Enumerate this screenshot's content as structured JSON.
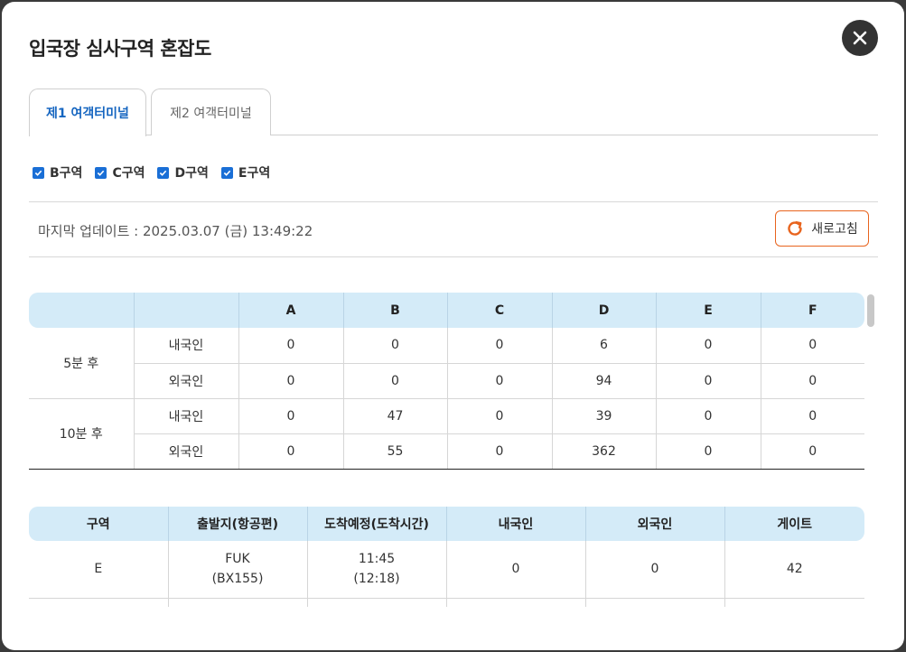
{
  "modal": {
    "title": "입국장 심사구역 혼잡도"
  },
  "tabs": [
    {
      "label": "제1 여객터미널",
      "active": true
    },
    {
      "label": "제2 여객터미널",
      "active": false
    }
  ],
  "filters": [
    {
      "label": "B구역",
      "checked": true
    },
    {
      "label": "C구역",
      "checked": true
    },
    {
      "label": "D구역",
      "checked": true
    },
    {
      "label": "E구역",
      "checked": true
    }
  ],
  "status": {
    "last_update": "마지막 업데이트 : 2025.03.07 (금) 13:49:22",
    "refresh_label": "새로고침"
  },
  "congestion_table": {
    "columns": [
      "",
      "",
      "A",
      "B",
      "C",
      "D",
      "E",
      "F"
    ],
    "groups": [
      {
        "label": "5분 후",
        "rows": [
          {
            "type": "내국인",
            "values": [
              "0",
              "0",
              "0",
              "6",
              "0",
              "0"
            ]
          },
          {
            "type": "외국인",
            "values": [
              "0",
              "0",
              "0",
              "94",
              "0",
              "0"
            ]
          }
        ]
      },
      {
        "label": "10분 후",
        "rows": [
          {
            "type": "내국인",
            "values": [
              "0",
              "47",
              "0",
              "39",
              "0",
              "0"
            ]
          },
          {
            "type": "외국인",
            "values": [
              "0",
              "55",
              "0",
              "362",
              "0",
              "0"
            ]
          }
        ]
      }
    ]
  },
  "flights_table": {
    "columns": [
      "구역",
      "출발지(항공편)",
      "도착예정(도착시간)",
      "내국인",
      "외국인",
      "게이트"
    ],
    "rows": [
      {
        "zone": "E",
        "origin": "FUK",
        "flight": "(BX155)",
        "eta": "11:45",
        "arrival": "(12:18)",
        "domestic": "0",
        "foreign": "0",
        "gate": "42"
      },
      {
        "zone": "",
        "origin": "",
        "flight": "",
        "eta": "",
        "arrival": "",
        "domestic": "",
        "foreign": "",
        "gate": ""
      }
    ]
  },
  "colors": {
    "accent": "#1565c0",
    "header_bg": "#d4ebf8",
    "refresh_border": "#e8641e",
    "checkbox": "#1a6fd6"
  }
}
